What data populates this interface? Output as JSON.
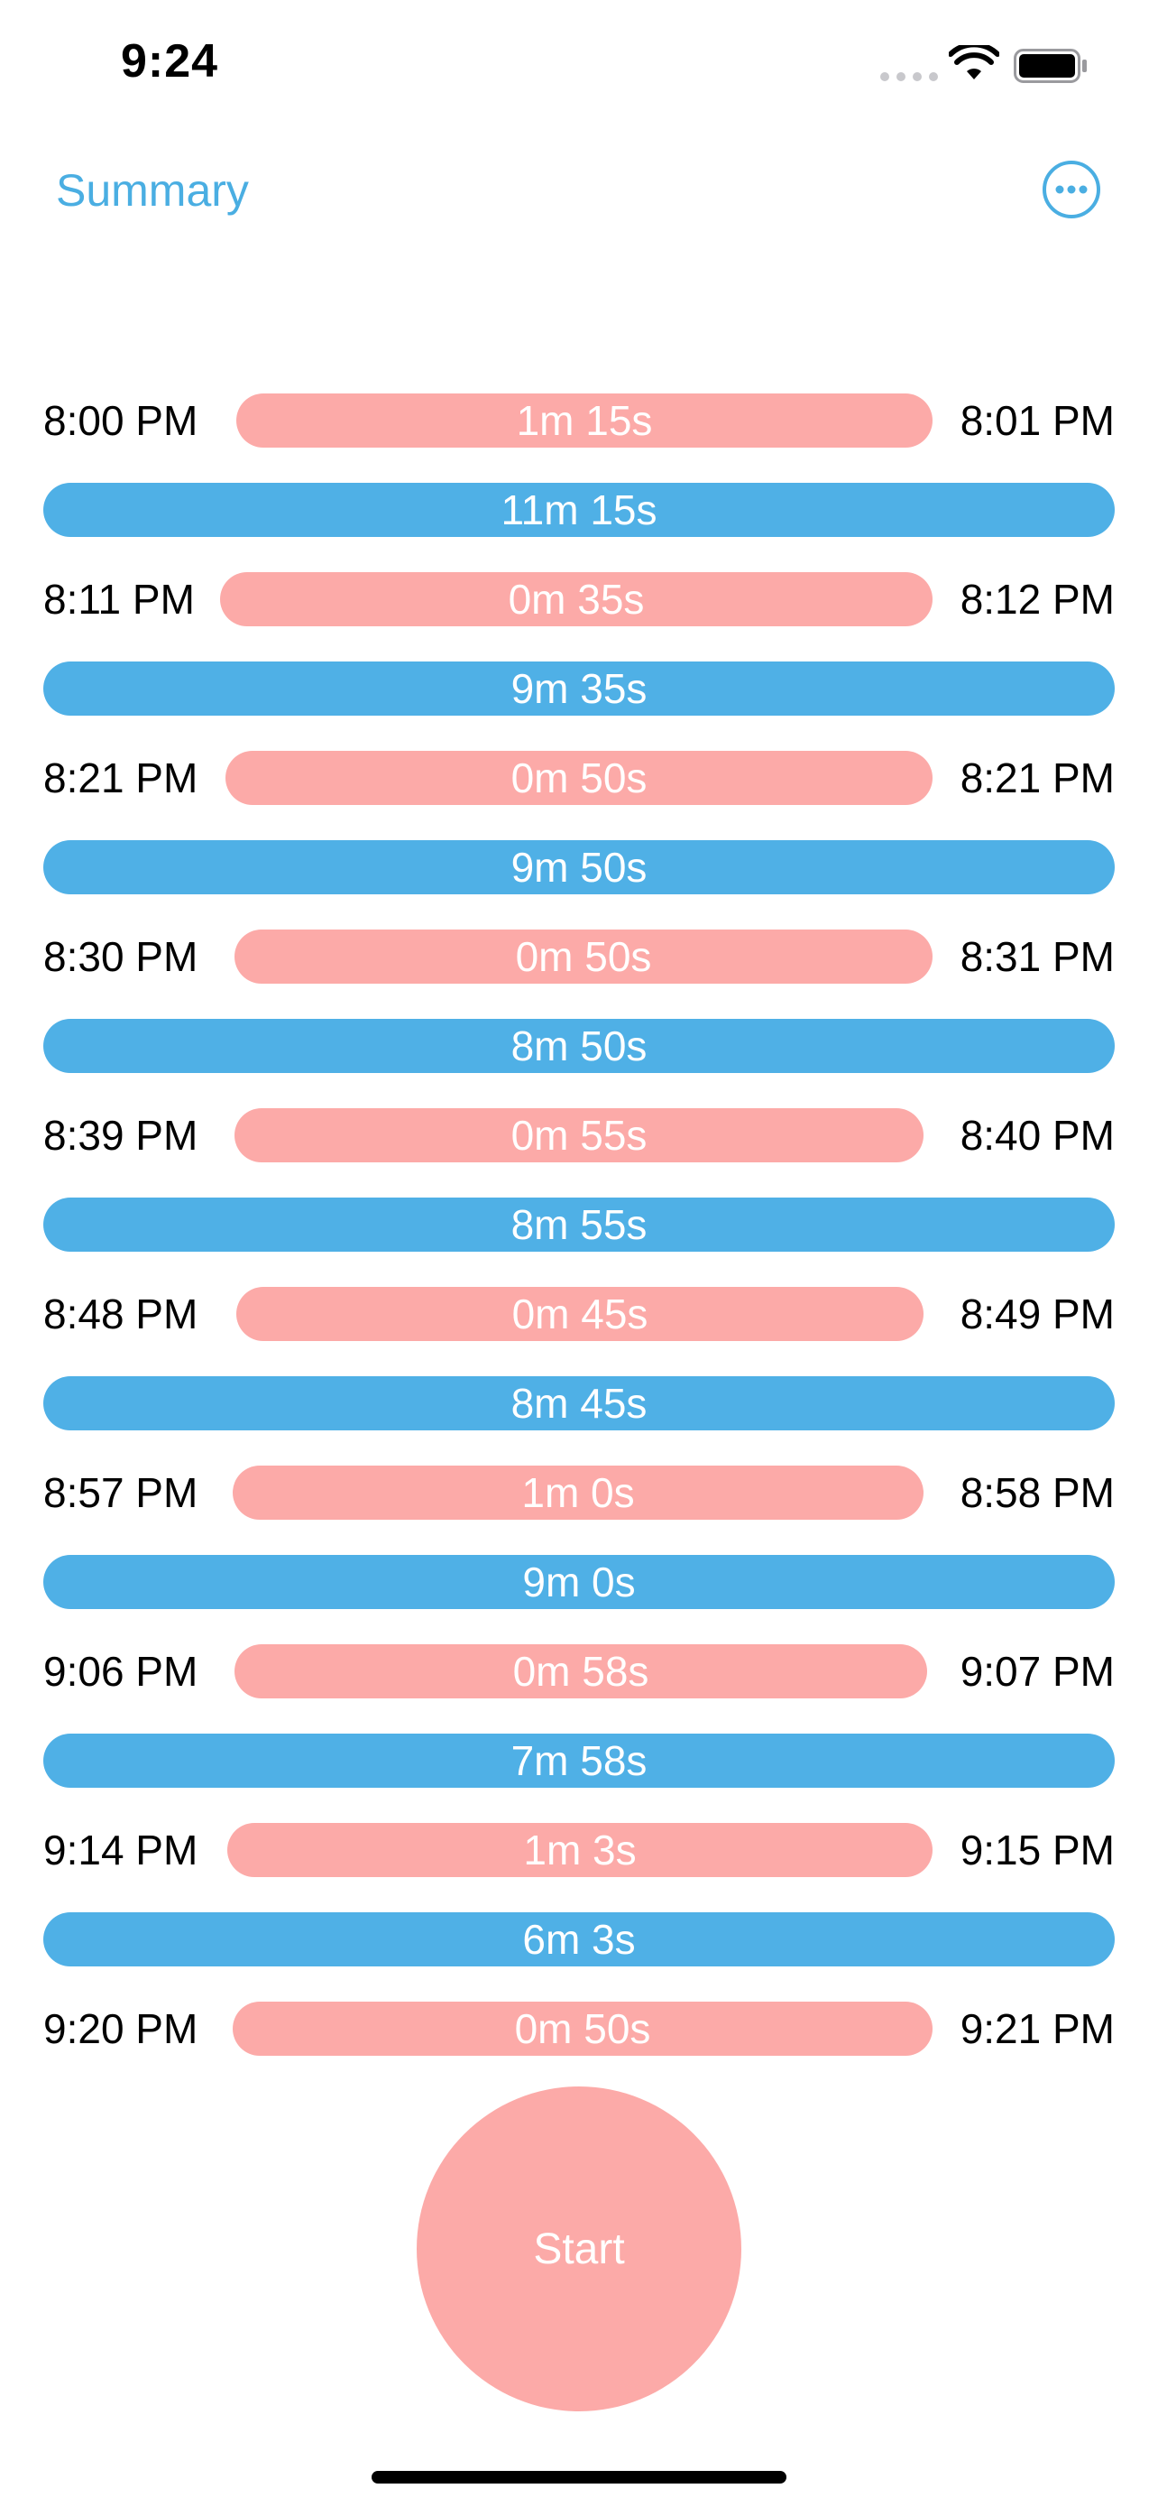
{
  "status_bar": {
    "time": "9:24"
  },
  "nav": {
    "summary_label": "Summary",
    "more_icon": "ellipsis-circle-icon"
  },
  "colors": {
    "accent": "#4aaee2",
    "work": "#fcaaa8",
    "gap": "#4fb0e6"
  },
  "timeline": {
    "sessions": [
      {
        "start": "8:00 PM",
        "duration": "1m 15s",
        "end": "8:01 PM"
      },
      {
        "gap": "11m 15s"
      },
      {
        "start": "8:11 PM",
        "duration": "0m 35s",
        "end": "8:12 PM"
      },
      {
        "gap": "9m 35s"
      },
      {
        "start": "8:21 PM",
        "duration": "0m 50s",
        "end": "8:21 PM"
      },
      {
        "gap": "9m 50s"
      },
      {
        "start": "8:30 PM",
        "duration": "0m 50s",
        "end": "8:31 PM"
      },
      {
        "gap": "8m 50s"
      },
      {
        "start": "8:39 PM",
        "duration": "0m 55s",
        "end": "8:40 PM"
      },
      {
        "gap": "8m 55s"
      },
      {
        "start": "8:48 PM",
        "duration": "0m 45s",
        "end": "8:49 PM"
      },
      {
        "gap": "8m 45s"
      },
      {
        "start": "8:57 PM",
        "duration": "1m 0s",
        "end": "8:58 PM"
      },
      {
        "gap": "9m 0s"
      },
      {
        "start": "9:06 PM",
        "duration": "0m 58s",
        "end": "9:07 PM"
      },
      {
        "gap": "7m 58s"
      },
      {
        "start": "9:14 PM",
        "duration": "1m 3s",
        "end": "9:15 PM"
      },
      {
        "gap": "6m 3s"
      },
      {
        "start": "9:20 PM",
        "duration": "0m 50s",
        "end": "9:21 PM"
      }
    ]
  },
  "start_button": {
    "label": "Start"
  }
}
